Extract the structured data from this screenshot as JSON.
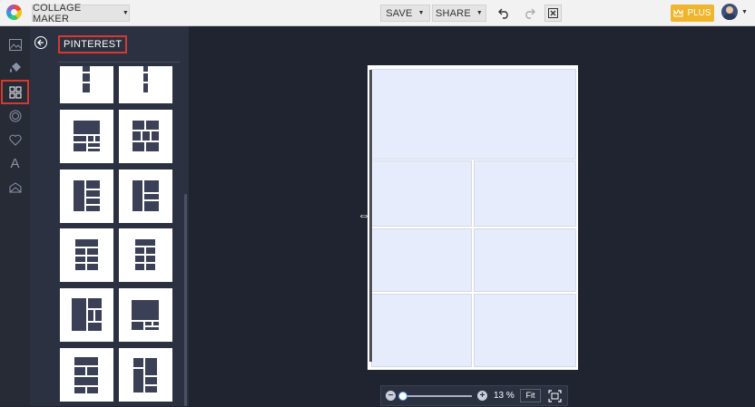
{
  "topbar": {
    "app_selector": "COLLAGE MAKER",
    "save": "SAVE",
    "share": "SHARE",
    "plus": "PLUS",
    "icons": [
      "undo-icon",
      "redo-icon",
      "close-icon",
      "crown-icon",
      "avatar"
    ]
  },
  "leftbar": {
    "icons": [
      "image-icon",
      "paint-bucket-icon",
      "layout-grid-icon",
      "circle-icon",
      "heart-icon",
      "text-icon",
      "overlay-icon"
    ],
    "active": "layout-grid-icon"
  },
  "panel": {
    "title": "PINTEREST",
    "template_count_visible": 12
  },
  "zoom": {
    "percent": "13 %",
    "fit": "Fit",
    "level": 0.13
  },
  "colors": {
    "accent_red": "#d43a2f",
    "plus_gold": "#f0b52e",
    "cell_fill": "#e7ecfc",
    "dark_bg": "#1f2430",
    "panel_bg": "#2b3140"
  }
}
